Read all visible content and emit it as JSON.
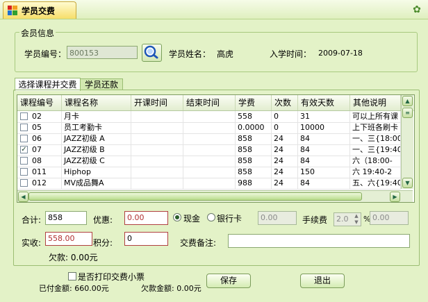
{
  "window": {
    "title": "学员交费",
    "close_glyph": "✿"
  },
  "member": {
    "legend": "会员信息",
    "id_label": "学员编号：",
    "id_value": "800153",
    "name_label": "学员姓名：",
    "name_value": "高虎",
    "enroll_label": "入学时间：",
    "enroll_value": "2009-07-18"
  },
  "tabs": [
    {
      "label": "选择课程并交费"
    },
    {
      "label": "学员还款"
    }
  ],
  "grid": {
    "columns": [
      "课程编号",
      "课程名称",
      "开课时间",
      "结束时间",
      "学费",
      "次数",
      "有效天数",
      "其他说明"
    ],
    "rows": [
      {
        "checked": false,
        "code": "02",
        "name": "月卡",
        "start": "",
        "end": "",
        "fee": "558",
        "times": "0",
        "days": "31",
        "note": "可以上所有课"
      },
      {
        "checked": false,
        "code": "05",
        "name": "员工考勤卡",
        "start": "",
        "end": "",
        "fee": "0.0000",
        "times": "0",
        "days": "10000",
        "note": "上下班各刷卡"
      },
      {
        "checked": false,
        "code": "06",
        "name": "JAZZ初级 A",
        "start": "",
        "end": "",
        "fee": "858",
        "times": "24",
        "days": "84",
        "note": "一、三{18:00"
      },
      {
        "checked": true,
        "code": "07",
        "name": "JAZZ初级 B",
        "start": "",
        "end": "",
        "fee": "858",
        "times": "24",
        "days": "84",
        "note": "一、三{19:40"
      },
      {
        "checked": false,
        "code": "08",
        "name": "JAZZ初级 C",
        "start": "",
        "end": "",
        "fee": "858",
        "times": "24",
        "days": "84",
        "note": "六（18:00-"
      },
      {
        "checked": false,
        "code": "011",
        "name": "Hiphop",
        "start": "",
        "end": "",
        "fee": "858",
        "times": "24",
        "days": "150",
        "note": "六 19:40-2"
      },
      {
        "checked": false,
        "code": "012",
        "name": "MV成品舞A",
        "start": "",
        "end": "",
        "fee": "988",
        "times": "24",
        "days": "84",
        "note": "五、六{19:40"
      }
    ]
  },
  "form": {
    "total_label": "合计:",
    "total_value": "858",
    "discount_label": "优惠:",
    "discount_value": "0.00",
    "cash_label": "现金",
    "bank_label": "银行卡",
    "bank_amount": "0.00",
    "fee_label": "手续费",
    "fee_rate": "2.0",
    "percent": "%",
    "fee_amount": "0.00",
    "paid_label": "实收:",
    "paid_value": "558.00",
    "points_label": "积分:",
    "points_value": "0",
    "remark_label": "交费备注:",
    "remark_value": "",
    "debt_text": "欠款: 0.00元",
    "print_label": "是否打印交费小票",
    "paid_amount_text": "已付金额: 660.00元",
    "debt_amount_text": "欠款金额: 0.00元",
    "save_label": "保存",
    "exit_label": "退出"
  }
}
